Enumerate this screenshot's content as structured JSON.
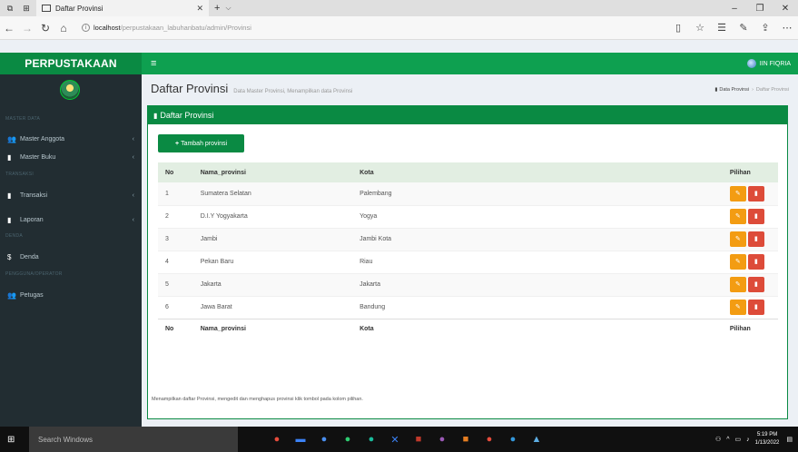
{
  "browser": {
    "tab_title": "Daftar Provinsi",
    "url_host": "localhost",
    "url_path": "/perpustakaan_labuhanbatu/admin/Provinsi"
  },
  "app": {
    "brand": "PERPUSTAKAAN",
    "user_name": "IIN FIQRIA"
  },
  "sidebar": {
    "sections": [
      "MASTER DATA",
      "TRANSAKSI",
      "DENDA",
      "PENGGUNA/OPERATOR"
    ],
    "items": [
      {
        "label": "Master Anggota",
        "icon": "users-icon"
      },
      {
        "label": "Master Buku",
        "icon": "book-icon"
      },
      {
        "label": "Transaksi",
        "icon": "book-icon"
      },
      {
        "label": "Laporan",
        "icon": "book-icon"
      },
      {
        "label": "Denda",
        "icon": "dollar-icon"
      },
      {
        "label": "Petugas",
        "icon": "users-icon"
      }
    ]
  },
  "content": {
    "title": "Daftar Provinsi",
    "subtitle": "Data Master Provinsi, Menampilkan data Provinsi",
    "breadcrumb": [
      "Data Provinsi",
      "Daftar Provinsi"
    ],
    "box_title": "Daftar Provinsi",
    "add_button": "Tambah provinsi",
    "columns": [
      "No",
      "Nama_provinsi",
      "Kota",
      "Pilihan"
    ],
    "rows": [
      {
        "no": "1",
        "provinsi": "Sumatera Selatan",
        "kota": "Palembang"
      },
      {
        "no": "2",
        "provinsi": "D.I.Y Yogyakarta",
        "kota": "Yogya"
      },
      {
        "no": "3",
        "provinsi": "Jambi",
        "kota": "Jambi Kota"
      },
      {
        "no": "4",
        "provinsi": "Pekan Baru",
        "kota": "Riau"
      },
      {
        "no": "5",
        "provinsi": "Jakarta",
        "kota": "Jakarta"
      },
      {
        "no": "6",
        "provinsi": "Jawa Barat",
        "kota": "Bandung"
      }
    ],
    "footnote": "Menampilkan daftar Provinsi, mengedit dan menghapus provinsi klik tombol pada kolom pilihan."
  },
  "taskbar": {
    "search_placeholder": "Search Windows",
    "time": "5:19 PM",
    "date": "1/13/2022"
  },
  "colors": {
    "brand_green": "#0a8a43",
    "topnav_green": "#0ea050",
    "sidebar_bg": "#222d32",
    "edit_orange": "#f39c12",
    "delete_red": "#dd4b39"
  }
}
